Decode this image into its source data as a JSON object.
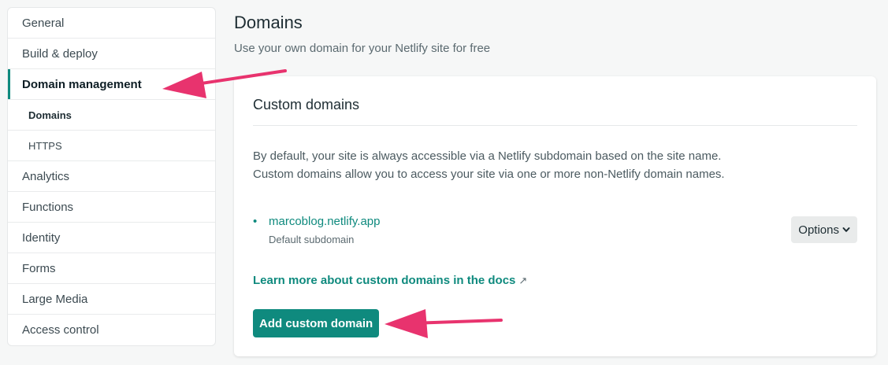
{
  "sidebar": {
    "items": [
      {
        "label": "General"
      },
      {
        "label": "Build & deploy"
      },
      {
        "label": "Domain management"
      },
      {
        "label": "Domains"
      },
      {
        "label": "HTTPS"
      },
      {
        "label": "Analytics"
      },
      {
        "label": "Functions"
      },
      {
        "label": "Identity"
      },
      {
        "label": "Forms"
      },
      {
        "label": "Large Media"
      },
      {
        "label": "Access control"
      }
    ]
  },
  "header": {
    "title": "Domains",
    "subtitle": "Use your own domain for your Netlify site for free"
  },
  "card": {
    "title": "Custom domains",
    "description_line1": "By default, your site is always accessible via a Netlify subdomain based on the site name.",
    "description_line2": "Custom domains allow you to access your site via one or more non-Netlify domain names.",
    "domain": {
      "name": "marcoblog.netlify.app",
      "label": "Default subdomain"
    },
    "options_label": "Options",
    "docs_link": "Learn more about custom domains in the docs",
    "docs_icon": "↗",
    "add_button": "Add custom domain"
  },
  "colors": {
    "accent": "#0f8a7e",
    "annotation_arrow": "#e8336e"
  },
  "icons": {
    "external": "external-link-icon",
    "options": "chevron-down-icon",
    "annotation": "arrow-icon"
  }
}
